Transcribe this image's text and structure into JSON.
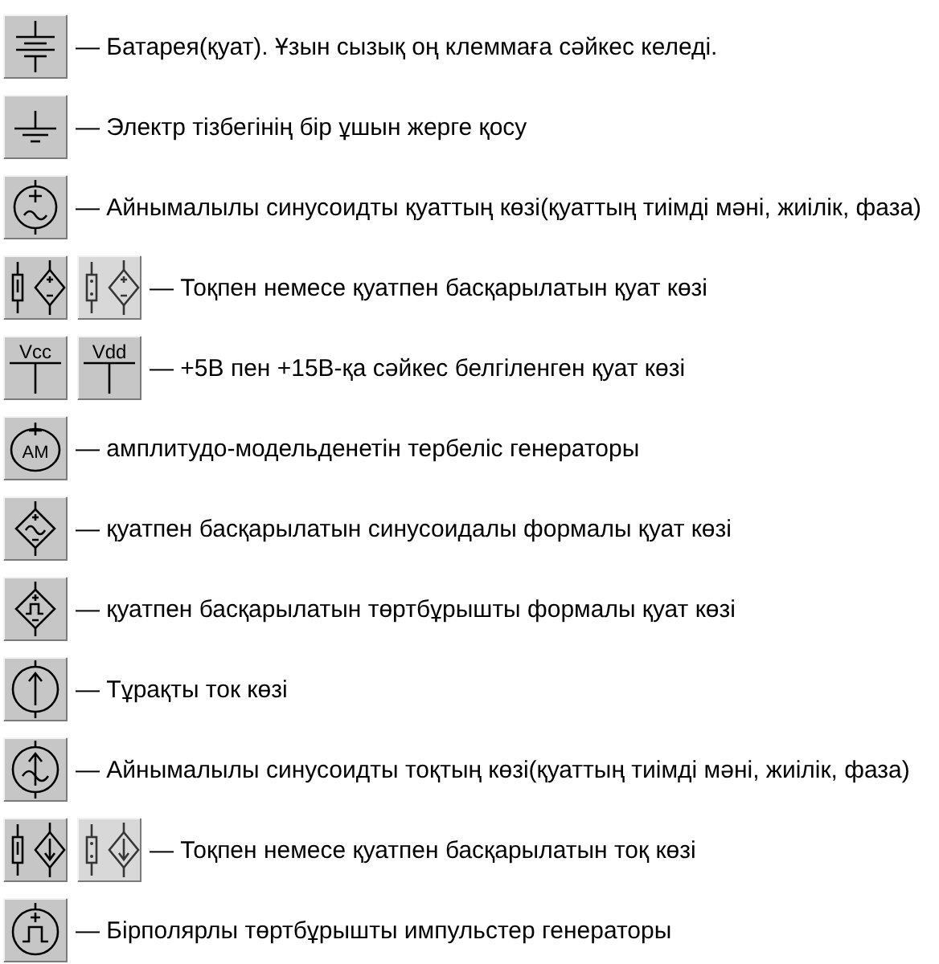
{
  "rows": [
    {
      "icons": [
        {
          "kind": "battery"
        }
      ],
      "text": "— Батарея(қуат). Ұзын сызық оң клеммаға сәйкес келеді."
    },
    {
      "icons": [
        {
          "kind": "ground"
        }
      ],
      "text": "— Электр тізбегінің бір ұшын жерге қосу"
    },
    {
      "icons": [
        {
          "kind": "ac-voltage"
        }
      ],
      "text": "— Айнымалылы синусоидты қуаттың көзі(қуаттың тиімді мәні, жиілік, фаза)"
    },
    {
      "icons": [
        {
          "kind": "controlled-voltage"
        },
        {
          "kind": "controlled-voltage-alt"
        }
      ],
      "text": "— Тоқпен немесе қуатпен басқарылатын қуат көзі"
    },
    {
      "icons": [
        {
          "kind": "supply",
          "label": "Vcc"
        },
        {
          "kind": "supply",
          "label": "Vdd"
        }
      ],
      "text": "— +5В пен +15В-қа сәйкес белгіленген қуат көзі"
    },
    {
      "icons": [
        {
          "kind": "am",
          "label": "AM"
        }
      ],
      "text": "— амплитудо-модельденетін тербеліс генераторы"
    },
    {
      "icons": [
        {
          "kind": "controlled-sine"
        }
      ],
      "text": "— қуатпен басқарылатын синусоидалы формалы қуат көзі"
    },
    {
      "icons": [
        {
          "kind": "controlled-square"
        }
      ],
      "text": "— қуатпен басқарылатын төртбұрышты формалы қуат көзі"
    },
    {
      "icons": [
        {
          "kind": "dc-current"
        }
      ],
      "text": "— Тұрақты ток көзі"
    },
    {
      "icons": [
        {
          "kind": "ac-current"
        }
      ],
      "text": "— Айнымалылы синусоидты тоқтың көзі(қуаттың тиімді мәні, жиілік, фаза)"
    },
    {
      "icons": [
        {
          "kind": "controlled-current"
        },
        {
          "kind": "controlled-current-alt"
        }
      ],
      "text": "— Тоқпен немесе қуатпен басқарылатын тоқ көзі"
    },
    {
      "icons": [
        {
          "kind": "pulse"
        }
      ],
      "text": "— Бірполярлы төртбұрышты импульстер генераторы"
    }
  ]
}
